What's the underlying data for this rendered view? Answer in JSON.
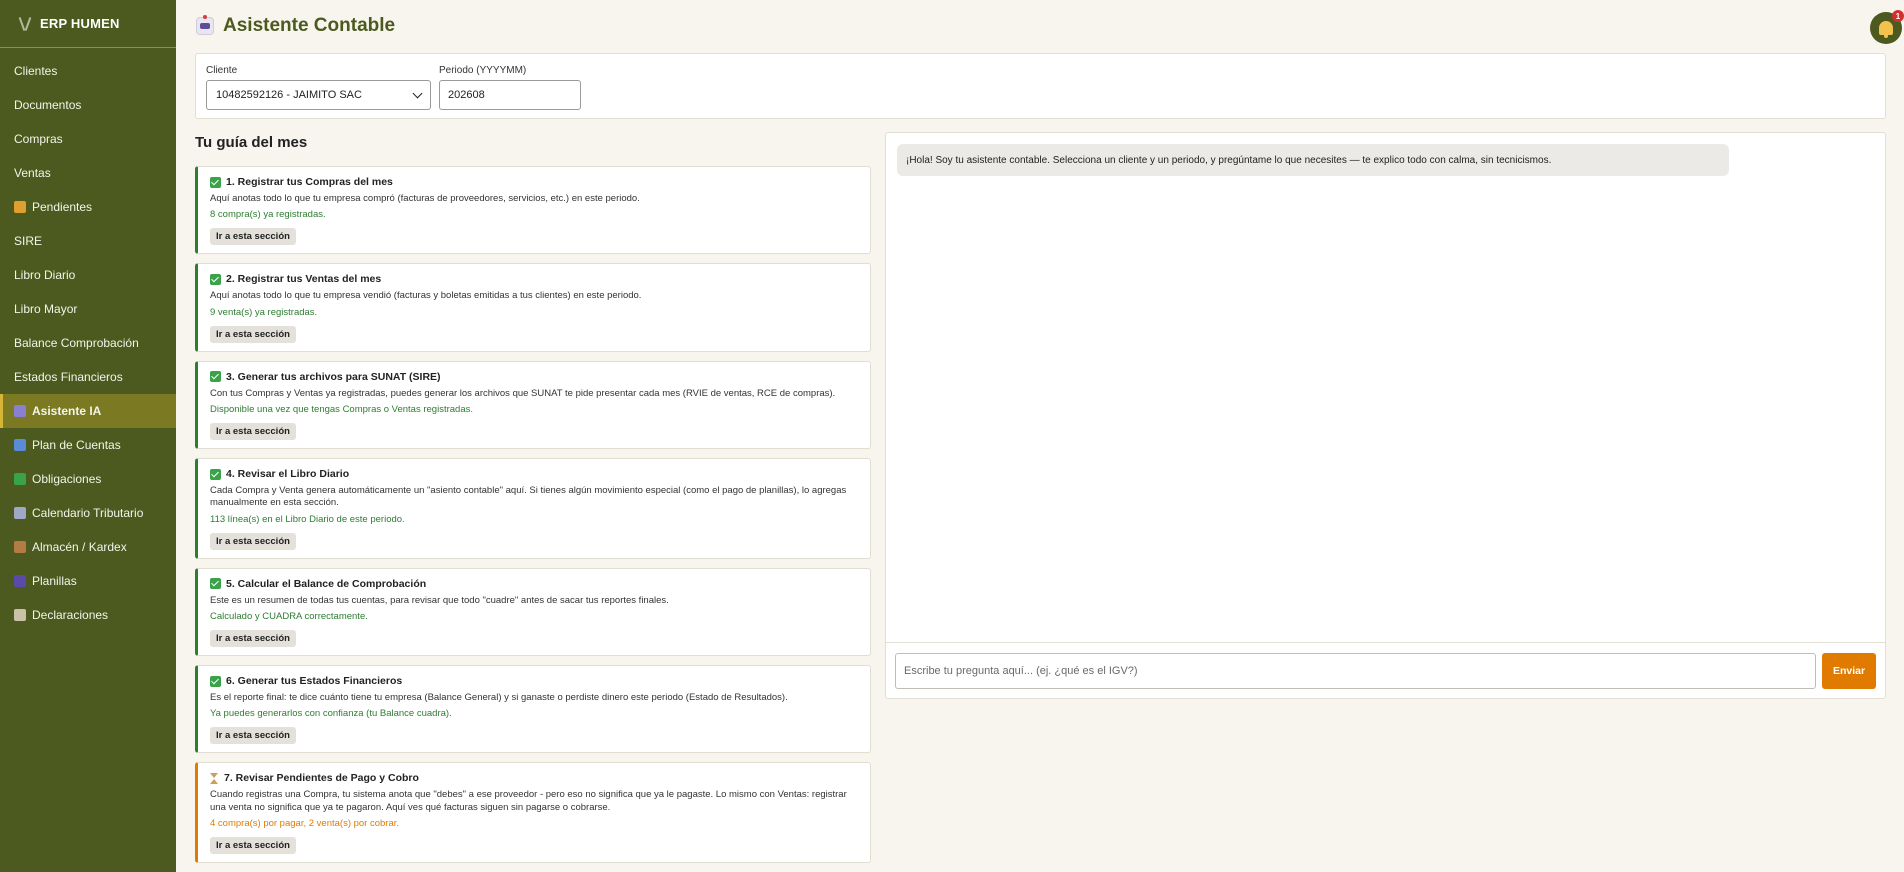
{
  "app": {
    "name": "ERP HUMEN"
  },
  "sidebar": {
    "items": [
      {
        "label": "Clientes",
        "icon": "",
        "icon_color": ""
      },
      {
        "label": "Documentos",
        "icon": "",
        "icon_color": ""
      },
      {
        "label": "Compras",
        "icon": "",
        "icon_color": ""
      },
      {
        "label": "Ventas",
        "icon": "",
        "icon_color": ""
      },
      {
        "label": "Pendientes",
        "icon": "money-bag-icon",
        "icon_color": "#e0a030"
      },
      {
        "label": "SIRE",
        "icon": "",
        "icon_color": ""
      },
      {
        "label": "Libro Diario",
        "icon": "",
        "icon_color": ""
      },
      {
        "label": "Libro Mayor",
        "icon": "",
        "icon_color": ""
      },
      {
        "label": "Balance Comprobación",
        "icon": "",
        "icon_color": ""
      },
      {
        "label": "Estados Financieros",
        "icon": "",
        "icon_color": ""
      },
      {
        "label": "Asistente IA",
        "icon": "robot-icon",
        "icon_color": "#8b7fd0",
        "active": true
      },
      {
        "label": "Plan de Cuentas",
        "icon": "book-icon",
        "icon_color": "#5a8bd6"
      },
      {
        "label": "Obligaciones",
        "icon": "checkbox-icon",
        "icon_color": "#3aa34a"
      },
      {
        "label": "Calendario Tributario",
        "icon": "calendar-icon",
        "icon_color": "#9fa8c6"
      },
      {
        "label": "Almacén / Kardex",
        "icon": "package-icon",
        "icon_color": "#b57b45"
      },
      {
        "label": "Planillas",
        "icon": "people-icon",
        "icon_color": "#5b4aa8"
      },
      {
        "label": "Declaraciones",
        "icon": "document-icon",
        "icon_color": "#c9c2a8"
      }
    ]
  },
  "header": {
    "title": "Asistente Contable",
    "notification_count": "1"
  },
  "filters": {
    "client_label": "Cliente",
    "client_value": "10482592126 - JAIMITO SAC",
    "period_label": "Periodo (YYYYMM)",
    "period_value": "202608"
  },
  "guide": {
    "title": "Tu guía del mes",
    "button_label": "Ir a esta sección",
    "steps": [
      {
        "title": "1. Registrar tus Compras del mes",
        "desc": "Aquí anotas todo lo que tu empresa compró (facturas de proveedores, servicios, etc.) en este periodo.",
        "status": "8 compra(s) ya registradas.",
        "done": true
      },
      {
        "title": "2. Registrar tus Ventas del mes",
        "desc": "Aquí anotas todo lo que tu empresa vendió (facturas y boletas emitidas a tus clientes) en este periodo.",
        "status": "9 venta(s) ya registradas.",
        "done": true
      },
      {
        "title": "3. Generar tus archivos para SUNAT (SIRE)",
        "desc": "Con tus Compras y Ventas ya registradas, puedes generar los archivos que SUNAT te pide presentar cada mes (RVIE de ventas, RCE de compras).",
        "status": "Disponible una vez que tengas Compras o Ventas registradas.",
        "done": true
      },
      {
        "title": "4. Revisar el Libro Diario",
        "desc": "Cada Compra y Venta genera automáticamente un \"asiento contable\" aquí. Si tienes algún movimiento especial (como el pago de planillas), lo agregas manualmente en esta sección.",
        "status": "113 línea(s) en el Libro Diario de este periodo.",
        "done": true
      },
      {
        "title": "5. Calcular el Balance de Comprobación",
        "desc": "Este es un resumen de todas tus cuentas, para revisar que todo \"cuadre\" antes de sacar tus reportes finales.",
        "status": "Calculado y CUADRA correctamente.",
        "done": true
      },
      {
        "title": "6. Generar tus Estados Financieros",
        "desc": "Es el reporte final: te dice cuánto tiene tu empresa (Balance General) y si ganaste o perdiste dinero este periodo (Estado de Resultados).",
        "status": "Ya puedes generarlos con confianza (tu Balance cuadra).",
        "done": true
      },
      {
        "title": "7. Revisar Pendientes de Pago y Cobro",
        "desc": "Cuando registras una Compra, tu sistema anota que \"debes\" a ese proveedor - pero eso no significa que ya le pagaste. Lo mismo con Ventas: registrar una venta no significa que ya te pagaron. Aquí ves qué facturas siguen sin pagarse o cobrarse.",
        "status": "4 compra(s) por pagar, 2 venta(s) por cobrar.",
        "done": false
      }
    ]
  },
  "chat": {
    "greeting": "¡Hola! Soy tu asistente contable. Selecciona un cliente y un periodo, y pregúntame lo que necesites — te explico todo con calma, sin tecnicismos.",
    "placeholder": "Escribe tu pregunta aquí... (ej. ¿qué es el IGV?)",
    "send_label": "Enviar"
  },
  "colors": {
    "sidebar_bg": "#4c5a1f",
    "accent": "#e07b00",
    "done": "#2e7d32"
  }
}
